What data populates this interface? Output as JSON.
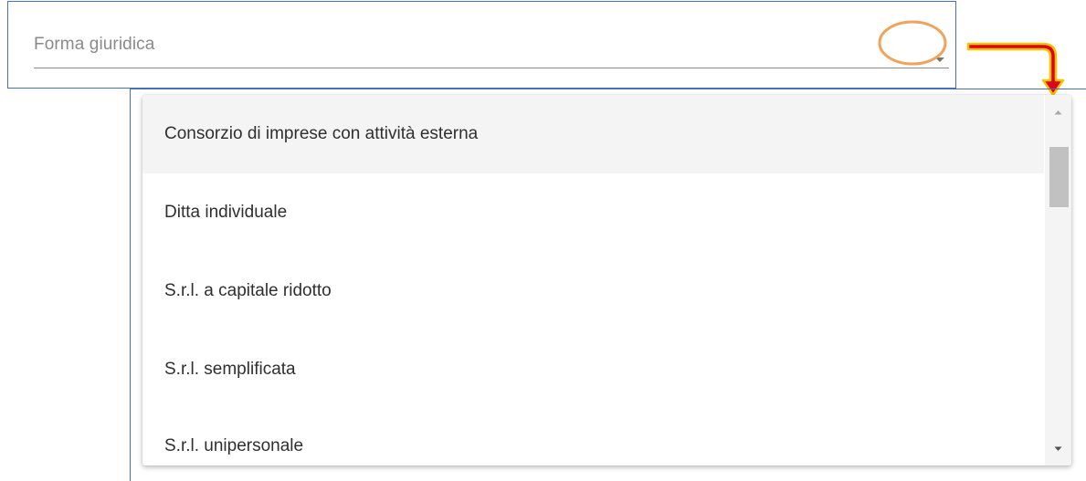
{
  "select": {
    "placeholder": "Forma giuridica",
    "icon": "chevron-down-icon"
  },
  "dropdown": {
    "items": [
      {
        "label": "Consorzio di imprese con attività esterna",
        "active": true
      },
      {
        "label": "Ditta individuale",
        "active": false
      },
      {
        "label": "S.r.l. a capitale ridotto",
        "active": false
      },
      {
        "label": "S.r.l. semplificata",
        "active": false
      },
      {
        "label": "S.r.l. unipersonale",
        "active": false
      }
    ]
  },
  "annotations": {
    "ring_color": "#f0a35a",
    "arrow_fill": "#e3001b",
    "arrow_outline": "#f4c400",
    "frame_color": "#4a6fb5"
  }
}
